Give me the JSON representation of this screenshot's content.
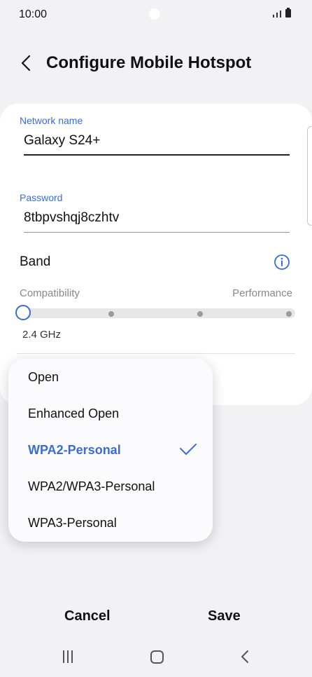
{
  "status_bar": {
    "time": "10:00"
  },
  "header": {
    "title": "Configure Mobile Hotspot"
  },
  "network": {
    "label": "Network name",
    "value": "Galaxy S24+"
  },
  "password": {
    "label": "Password",
    "value": "8tbpvshqj8czhtv"
  },
  "band": {
    "label": "Band",
    "left_label": "Compatibility",
    "right_label": "Performance",
    "value": "2.4 GHz",
    "level": 0
  },
  "security_menu": {
    "items": [
      "Open",
      "Enhanced Open",
      "WPA2-Personal",
      "WPA2/WPA3-Personal",
      "WPA3-Personal"
    ],
    "selected": "WPA2-Personal"
  },
  "buttons": {
    "cancel": "Cancel",
    "save": "Save"
  },
  "colors": {
    "accent": "#3d6dcc",
    "background": "#f2f2f5"
  }
}
